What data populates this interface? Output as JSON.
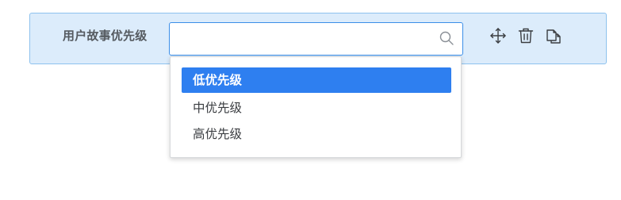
{
  "field": {
    "label": "用户故事优先级",
    "value": "",
    "placeholder": ""
  },
  "icons": {
    "search": "search-icon",
    "move": "move-icon",
    "delete": "trash-icon",
    "copy": "copy-icon"
  },
  "dropdown": {
    "options": [
      {
        "label": "低优先级",
        "selected": true
      },
      {
        "label": "中优先级",
        "selected": false
      },
      {
        "label": "高优先级",
        "selected": false
      }
    ]
  },
  "colors": {
    "row_background": "#dcecfb",
    "row_border": "#8ec2ee",
    "input_border": "#3b8ee8",
    "selected_option": "#2e7ff0"
  }
}
